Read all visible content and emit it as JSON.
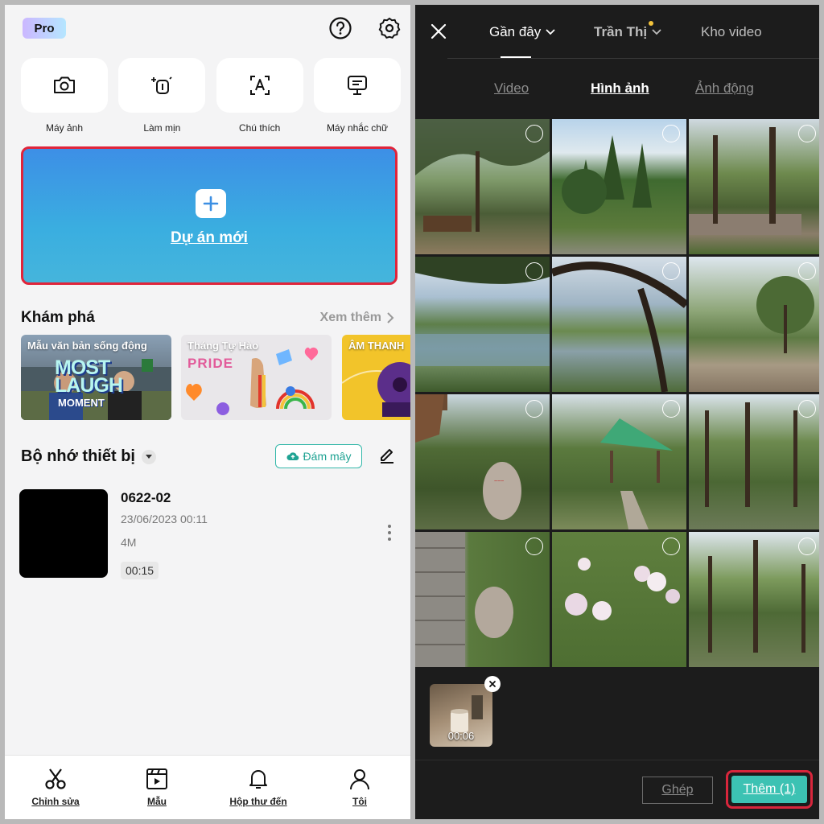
{
  "left": {
    "pro_badge": "Pro",
    "tools": [
      {
        "label": "Máy ảnh",
        "icon": "camera-icon"
      },
      {
        "label": "Làm mịn",
        "icon": "retouch-icon"
      },
      {
        "label": "Chú thích",
        "icon": "caption-icon"
      },
      {
        "label": "Máy nhắc chữ",
        "icon": "teleprompter-icon"
      }
    ],
    "new_project_label": "Dự án mới",
    "explore": {
      "title": "Khám phá",
      "see_more": "Xem thêm",
      "cards": [
        {
          "title": "Mẫu văn bản sống động",
          "art_line1": "MOST",
          "art_line2": "LAUGH",
          "art_line3": "MOMENT"
        },
        {
          "title": "Tháng Tự Hào",
          "art_text": "PRIDE"
        },
        {
          "title": "ÂM THANH"
        }
      ]
    },
    "storage": {
      "title": "Bộ nhớ thiết bị",
      "cloud_button": "Đám mây"
    },
    "project": {
      "name": "0622-02",
      "date": "23/06/2023 00:11",
      "size": "4M",
      "duration": "00:15"
    },
    "tabbar": [
      {
        "label": "Chỉnh sửa",
        "icon": "scissors-icon"
      },
      {
        "label": "Mẫu",
        "icon": "template-icon"
      },
      {
        "label": "Hộp thư đến",
        "icon": "bell-icon"
      },
      {
        "label": "Tôi",
        "icon": "profile-icon"
      }
    ]
  },
  "right": {
    "top_tabs": [
      {
        "label": "Gần đây",
        "active": true
      },
      {
        "label": "Trần Thị",
        "active": false
      },
      {
        "label": "Kho video",
        "active": false
      }
    ],
    "sub_tabs": [
      {
        "label": "Video",
        "active": false
      },
      {
        "label": "Hình ảnh",
        "active": true
      },
      {
        "label": "Ảnh động",
        "active": false
      }
    ],
    "selected_duration": "00:06",
    "merge_button": "Ghép",
    "add_button": "Thêm (1)"
  },
  "colors": {
    "accent_teal": "#3cc2b3",
    "highlight_red": "#e0243a",
    "gradient_blue": "#3d8fe6"
  }
}
